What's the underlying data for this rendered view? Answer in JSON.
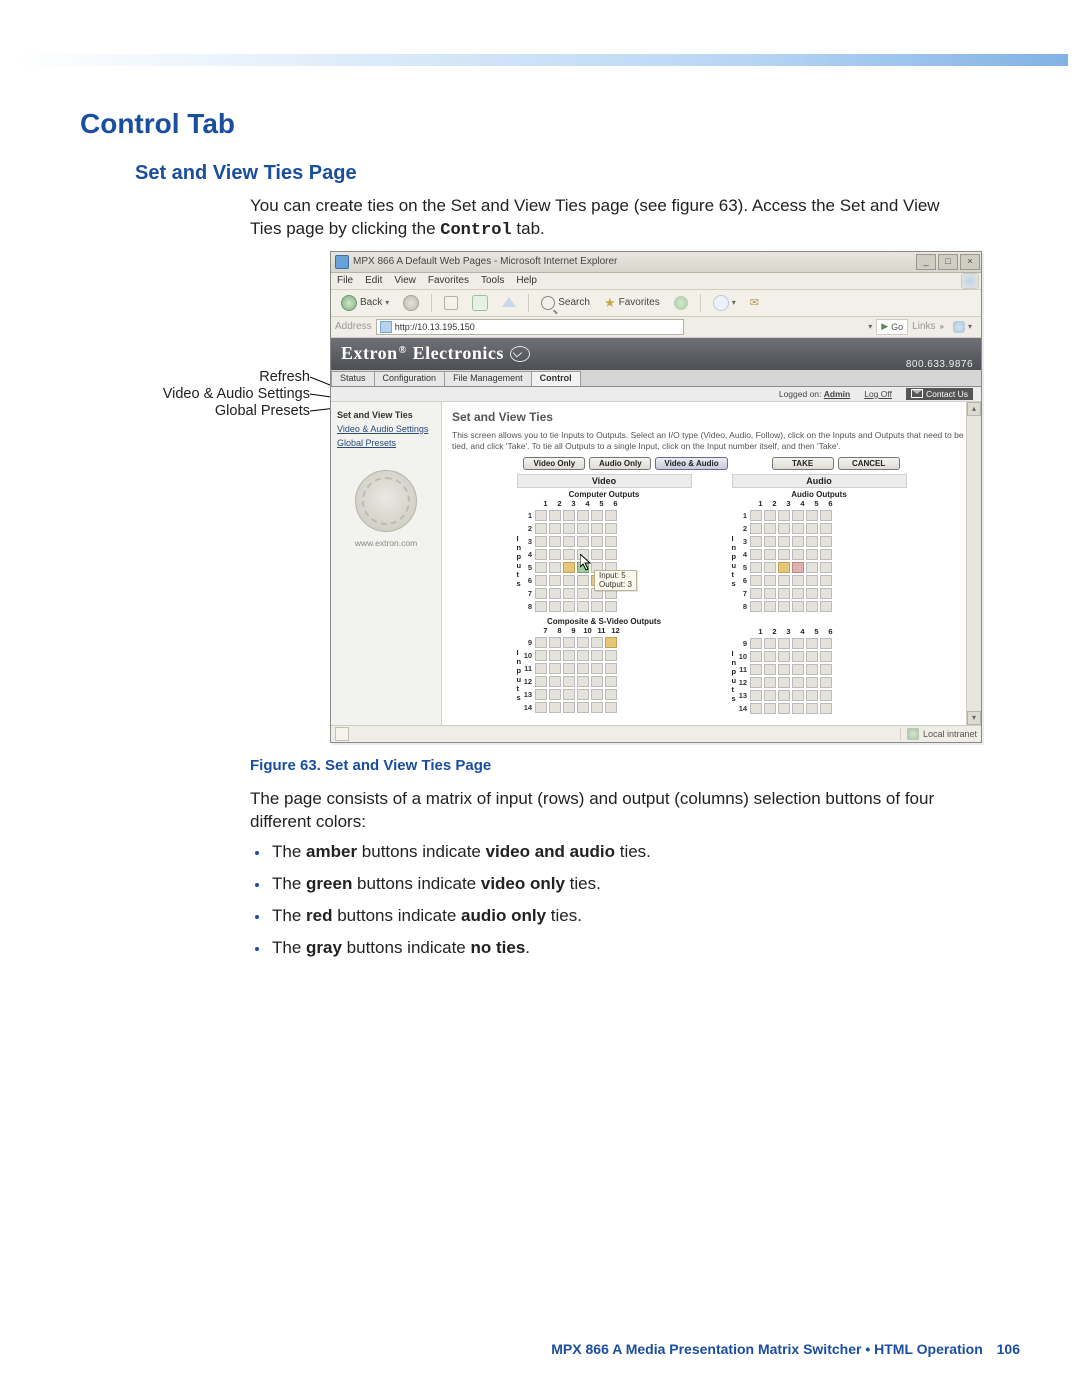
{
  "headings": {
    "h1": "Control Tab",
    "h2": "Set and View Ties Page"
  },
  "intro": {
    "line": "You can create ties on the Set and View Ties page (see figure 63). Access the Set and View Ties page by clicking the ",
    "code": "Control",
    "tail": " tab."
  },
  "caption": "Figure 63. Set and View Ties Page",
  "after_fig": "The page consists of a matrix of input (rows) and output (columns) selection buttons of four different colors:",
  "bullets": [
    {
      "pre": "The ",
      "b1": "amber",
      "mid": " buttons indicate ",
      "b2": "video and audio",
      "post": " ties."
    },
    {
      "pre": "The ",
      "b1": "green",
      "mid": " buttons indicate ",
      "b2": "video only",
      "post": " ties."
    },
    {
      "pre": "The ",
      "b1": "red",
      "mid": " buttons indicate ",
      "b2": "audio only",
      "post": " ties."
    },
    {
      "pre": "The ",
      "b1": "gray",
      "mid": " buttons indicate ",
      "b2": "no ties",
      "post": "."
    }
  ],
  "callouts": {
    "refresh": "Refresh",
    "vas": "Video & Audio Settings",
    "global": "Global Presets"
  },
  "browser": {
    "title": "MPX 866 A Default Web Pages - Microsoft Internet Explorer",
    "menus": [
      "File",
      "Edit",
      "View",
      "Favorites",
      "Tools",
      "Help"
    ],
    "toolbar": {
      "back": "Back",
      "search": "Search",
      "favorites": "Favorites"
    },
    "address_label": "Address",
    "address_value": "http://10.13.195.150",
    "go": "Go",
    "links": "Links",
    "status_zone": "Local intranet"
  },
  "webpage": {
    "brand_a": "Extron",
    "brand_b": "Electronics",
    "phone": "800.633.9876",
    "tabs": [
      "Status",
      "Configuration",
      "File Management",
      "Control"
    ],
    "active_tab_index": 3,
    "logged_on": "Logged on:",
    "logged_user": "Admin",
    "logoff": "Log Off",
    "contact": "Contact Us",
    "sidebar": {
      "items": [
        "Set and View Ties",
        "Video & Audio Settings",
        "Global Presets"
      ],
      "url": "www.extron.com"
    },
    "pane_title": "Set and View Ties",
    "pane_desc": "This screen allows you to tie Inputs to Outputs. Select an I/O type (Video, Audio, Follow), click on the Inputs and Outputs that need to be tied, and click 'Take'. To tie all Outputs to a single Input, click on the Input number itself, and then 'Take'.",
    "pills": {
      "video_only": "Video Only",
      "audio_only": "Audio Only",
      "both": "Video & Audio",
      "take": "TAKE",
      "cancel": "CANCEL"
    },
    "matrices": {
      "video_title": "Video",
      "audio_title": "Audio",
      "computer_outputs": "Computer Outputs",
      "audio_outputs": "Audio Outputs",
      "composite_outputs": "Composite & S-Video Outputs",
      "cols_1_6": [
        "1",
        "2",
        "3",
        "4",
        "5",
        "6"
      ],
      "cols_7_12": [
        "7",
        "8",
        "9",
        "10",
        "11",
        "12"
      ],
      "rows_1_8": [
        "1",
        "2",
        "3",
        "4",
        "5",
        "6",
        "7",
        "8"
      ],
      "rows_9_14": [
        "9",
        "10",
        "11",
        "12",
        "13",
        "14"
      ],
      "inputs_label": [
        "I",
        "n",
        "p",
        "u",
        "t",
        "s"
      ]
    },
    "tooltip": {
      "line1": "Input: 5",
      "line2": "Output: 3"
    }
  },
  "footer": {
    "text": "MPX 866 A Media Presentation Matrix Switcher • HTML Operation",
    "page": "106"
  }
}
